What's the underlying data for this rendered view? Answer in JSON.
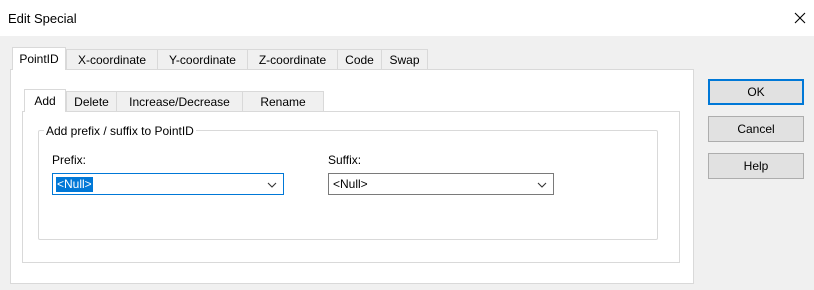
{
  "window": {
    "title": "Edit Special"
  },
  "outer_tabs": [
    {
      "label": "PointID",
      "active": true
    },
    {
      "label": "X-coordinate"
    },
    {
      "label": "Y-coordinate"
    },
    {
      "label": "Z-coordinate"
    },
    {
      "label": "Code"
    },
    {
      "label": "Swap"
    }
  ],
  "inner_tabs": [
    {
      "label": "Add",
      "active": true
    },
    {
      "label": "Delete"
    },
    {
      "label": "Increase/Decrease"
    },
    {
      "label": "Rename"
    }
  ],
  "add_group": {
    "title": "Add prefix / suffix to PointID",
    "prefix_label": "Prefix:",
    "prefix_value": "<Null>",
    "suffix_label": "Suffix:",
    "suffix_value": "<Null>"
  },
  "buttons": {
    "ok": "OK",
    "cancel": "Cancel",
    "help": "Help"
  },
  "colors": {
    "accent": "#0078d7",
    "dialog_bg": "#f0f0f0",
    "button_bg": "#e1e1e1"
  }
}
